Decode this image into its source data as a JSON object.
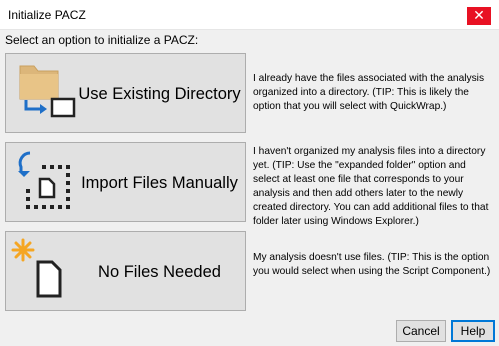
{
  "window": {
    "title": "Initialize PACZ",
    "close_glyph": "✕"
  },
  "prompt": "Select an option to initialize a PACZ:",
  "options": [
    {
      "label": "Use Existing Directory",
      "icon": "folder-with-arrow-icon",
      "description": "I already have the files associated with the analysis organized into a directory. (TIP: This is likely the option that you will select with QuickWrap.)"
    },
    {
      "label": "Import Files Manually",
      "icon": "import-file-arrow-icon",
      "description": "I haven't organized my analysis files into a directory yet. (TIP: Use the \"expanded folder\" option and select at least one file that corresponds to your analysis and then add others later to the newly created directory. You can add additional files to that folder later using Windows Explorer.)"
    },
    {
      "label": "No Files Needed",
      "icon": "new-file-sparkle-icon",
      "description": "My analysis doesn't use files. (TIP: This is the option you would select when using the Script Component.)"
    }
  ],
  "buttons": {
    "cancel": "Cancel",
    "help": "Help"
  },
  "colors": {
    "folder": "#dcb67a",
    "arrow": "#1e6fc8",
    "sparkle": "#f5a623",
    "close": "#e81123"
  }
}
